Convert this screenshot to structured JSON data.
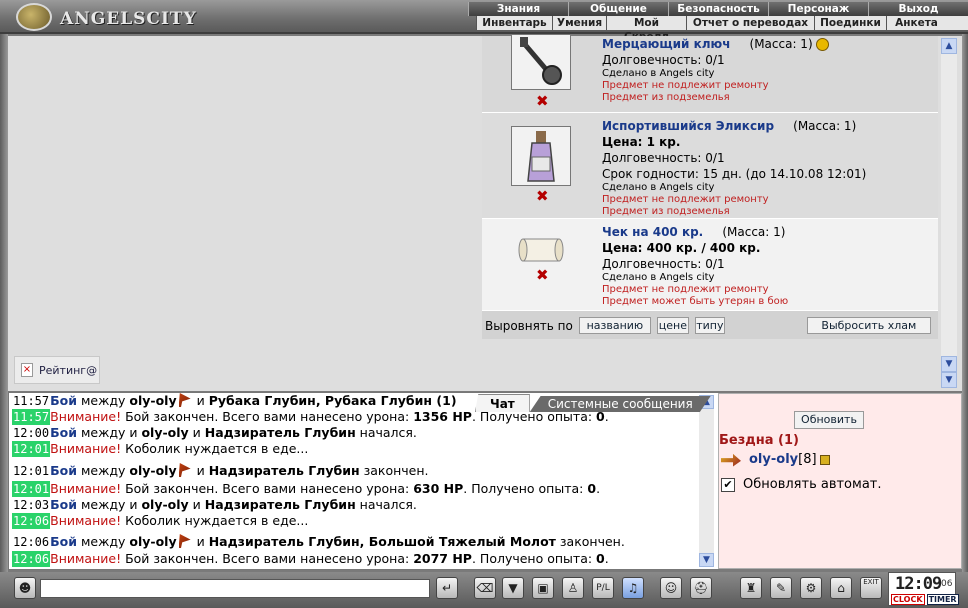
{
  "header": {
    "logo_text": "ANGELSCITY",
    "nav_primary": [
      "Знания",
      "Общение",
      "Безопасность",
      "Персонаж",
      "Выход"
    ],
    "nav_secondary": [
      "Инвентарь",
      "Умения",
      "Мой Скролл",
      "Отчет о переводах",
      "Поединки",
      "Анкета"
    ]
  },
  "rating": {
    "label": "Рейтинг@"
  },
  "items": [
    {
      "name": "Мерцающий ключ",
      "mass": "(Масса: 1)",
      "lines": [
        "Долговечность: 0/1"
      ],
      "made": "Сделано в Angels city",
      "notes": [
        "Предмет не подлежит ремонту",
        "Предмет из подземелья"
      ],
      "icon": "key-icon"
    },
    {
      "name": "Испортившийся Эликсир",
      "mass": "(Масса: 1)",
      "price": "Цена: 1 кр.",
      "lines": [
        "Долговечность: 0/1",
        "Срок годности: 15 дн. (до 14.10.08 12:01)"
      ],
      "made": "Сделано в Angels city",
      "notes": [
        "Предмет не подлежит ремонту",
        "Предмет из подземелья"
      ],
      "icon": "potion-icon"
    },
    {
      "name": "Чек на 400 кр.",
      "mass": "(Масса: 1)",
      "price": "Цена: 400 кр. / 400 кр.",
      "lines": [
        "Долговечность: 0/1"
      ],
      "made": "Сделано в Angels city",
      "notes": [
        "Предмет не подлежит ремонту",
        "Предмет может быть утерян в бою"
      ],
      "icon": "scroll-icon"
    }
  ],
  "sort": {
    "label": "Выровнять по",
    "by_name": "названию",
    "by_price": "цене",
    "by_type": "типу",
    "drop_junk": "Выбросить хлам"
  },
  "chat": {
    "tab_chat": "Чат",
    "tab_system": "Системные сообщения",
    "messages": [
      {
        "time": "11:57",
        "hl": false,
        "kind": "Бой",
        "p1": " между ",
        "a": "oly-oly",
        "flag": true,
        "p2": " и ",
        "b": "Рубака Глубин, Рубака Глубин (1)",
        "p3": ""
      },
      {
        "time": "11:57",
        "hl": true,
        "kind": "Внимание!",
        "p1": " Бой закончен. Всего вами нанесено урона: ",
        "a": "1356 HP",
        "flag": false,
        "p2": ". Получено опыта: ",
        "b": "0",
        "p3": "."
      },
      {
        "time": "12:00",
        "hl": false,
        "kind": "Бой",
        "p1": " между и ",
        "a": "oly-oly",
        "flag": false,
        "p2": " и ",
        "b": "Надзиратель Глубин",
        "p3": " начался."
      },
      {
        "time": "12:01",
        "hl": true,
        "kind": "Внимание!",
        "p1": " Коболик нуждается в еде...",
        "a": "",
        "flag": false,
        "p2": "",
        "b": "",
        "p3": ""
      },
      {
        "time": "12:01",
        "hl": false,
        "kind": "Бой",
        "p1": " между ",
        "a": "oly-oly",
        "flag": true,
        "p2": " и ",
        "b": "Надзиратель Глубин",
        "p3": " закончен."
      },
      {
        "time": "12:01",
        "hl": true,
        "kind": "Внимание!",
        "p1": " Бой закончен. Всего вами нанесено урона: ",
        "a": "630 HP",
        "flag": false,
        "p2": ". Получено опыта: ",
        "b": "0",
        "p3": "."
      },
      {
        "time": "12:03",
        "hl": false,
        "kind": "Бой",
        "p1": " между и ",
        "a": "oly-oly",
        "flag": false,
        "p2": " и ",
        "b": "Надзиратель Глубин",
        "p3": " начался."
      },
      {
        "time": "12:06",
        "hl": true,
        "kind": "Внимание!",
        "p1": " Коболик нуждается в еде...",
        "a": "",
        "flag": false,
        "p2": "",
        "b": "",
        "p3": ""
      },
      {
        "time": "12:06",
        "hl": false,
        "kind": "Бой",
        "p1": " между ",
        "a": "oly-oly",
        "flag": true,
        "p2": " и ",
        "b": "Надзиратель Глубин, Большой Тяжелый Молот",
        "p3": " закончен."
      },
      {
        "time": "12:06",
        "hl": true,
        "kind": "Внимание!",
        "p1": " Бой закончен. Всего вами нанесено урона: ",
        "a": "2077 HP",
        "flag": false,
        "p2": ". Получено опыта: ",
        "b": "0",
        "p3": "."
      }
    ]
  },
  "location": {
    "refresh_label": "Обновить",
    "title": "Бездна (1)",
    "user_name": "oly-oly",
    "user_level": "[8]",
    "auto_refresh_label": "Обновлять автомат.",
    "auto_refresh_checked": true
  },
  "clock": {
    "time": "12:09",
    "seconds": "06",
    "clock_label": "CLOCK",
    "timer_label": "TIMER"
  },
  "toolbar": {
    "exit_label": "EXIT",
    "pl_label": "P/L"
  }
}
